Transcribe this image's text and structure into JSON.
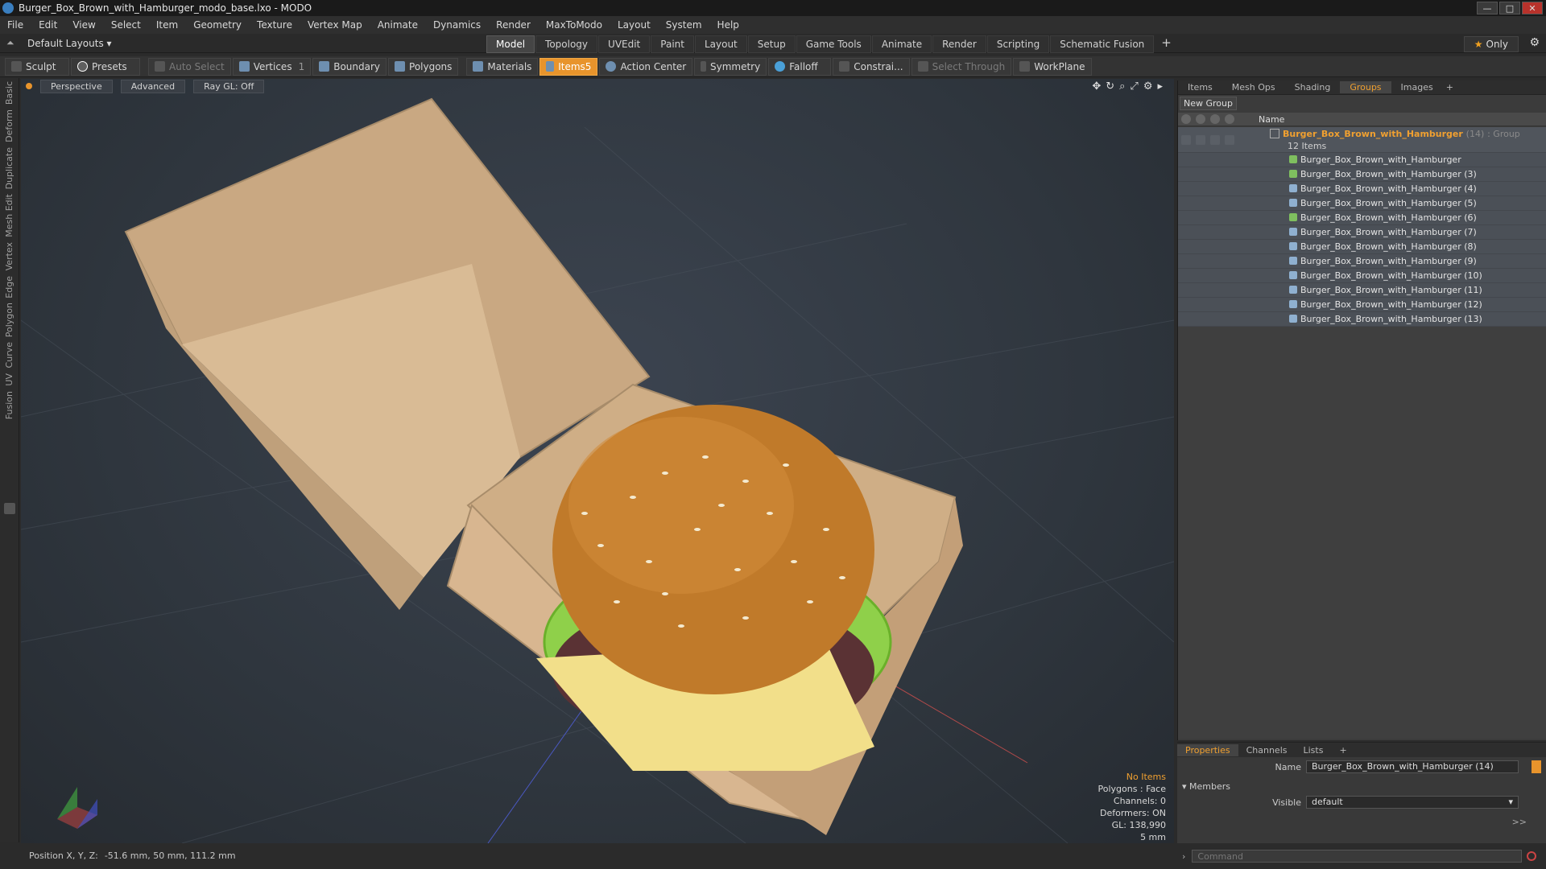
{
  "window": {
    "title": "Burger_Box_Brown_with_Hamburger_modo_base.lxo - MODO"
  },
  "menu": [
    "File",
    "Edit",
    "View",
    "Select",
    "Item",
    "Geometry",
    "Texture",
    "Vertex Map",
    "Animate",
    "Dynamics",
    "Render",
    "MaxToModo",
    "Layout",
    "System",
    "Help"
  ],
  "layouts": {
    "label": "Default Layouts ▾"
  },
  "tabs": [
    "Model",
    "Topology",
    "UVEdit",
    "Paint",
    "Layout",
    "Setup",
    "Game Tools",
    "Animate",
    "Render",
    "Scripting",
    "Schematic Fusion"
  ],
  "only": "Only",
  "toolbar": {
    "sculpt": "Sculpt",
    "presets": "Presets",
    "auto_select": "Auto Select",
    "vertices": "Vertices",
    "vertices_count": "1",
    "boundary": "Boundary",
    "polygons": "Polygons",
    "materials": "Materials",
    "items": "Items",
    "items_count": "5",
    "action_center": "Action Center",
    "symmetry": "Symmetry",
    "falloff": "Falloff",
    "constraints": "Constrai...",
    "select_through": "Select Through",
    "workplane": "WorkPlane"
  },
  "leftstrip": [
    "Basic",
    "Deform",
    "Duplicate",
    "Mesh Edit",
    "Vertex",
    "Edge",
    "Polygon",
    "Curve",
    "UV",
    "Fusion"
  ],
  "viewport": {
    "perspective": "Perspective",
    "advanced": "Advanced",
    "raygl": "Ray GL: Off",
    "info": {
      "no_items": "No Items",
      "polygons": "Polygons : Face",
      "channels": "Channels: 0",
      "deformers": "Deformers: ON",
      "gl": "GL: 138,990",
      "scale": "5 mm"
    }
  },
  "status": {
    "label": "Position X, Y, Z:",
    "value": "-51.6 mm, 50 mm, 111.2 mm"
  },
  "panel": {
    "tabs": [
      "Items",
      "Mesh Ops",
      "Shading",
      "Groups",
      "Images"
    ],
    "active_tab": "Groups",
    "new_group": "New Group",
    "name_header": "Name",
    "group": {
      "name": "Burger_Box_Brown_with_Hamburger",
      "count": "(14)",
      "type": ": Group",
      "items": "12 Items"
    },
    "items": [
      "Burger_Box_Brown_with_Hamburger",
      "Burger_Box_Brown_with_Hamburger (3)",
      "Burger_Box_Brown_with_Hamburger (4)",
      "Burger_Box_Brown_with_Hamburger (5)",
      "Burger_Box_Brown_with_Hamburger (6)",
      "Burger_Box_Brown_with_Hamburger (7)",
      "Burger_Box_Brown_with_Hamburger (8)",
      "Burger_Box_Brown_with_Hamburger (9)",
      "Burger_Box_Brown_with_Hamburger (10)",
      "Burger_Box_Brown_with_Hamburger (11)",
      "Burger_Box_Brown_with_Hamburger (12)",
      "Burger_Box_Brown_with_Hamburger (13)"
    ]
  },
  "properties": {
    "tabs": [
      "Properties",
      "Channels",
      "Lists"
    ],
    "name_label": "Name",
    "name_value": "Burger_Box_Brown_with_Hamburger (14)",
    "members": "Members",
    "visible_label": "Visible",
    "visible_value": "default",
    "more": ">>"
  },
  "command": {
    "placeholder": "Command"
  }
}
